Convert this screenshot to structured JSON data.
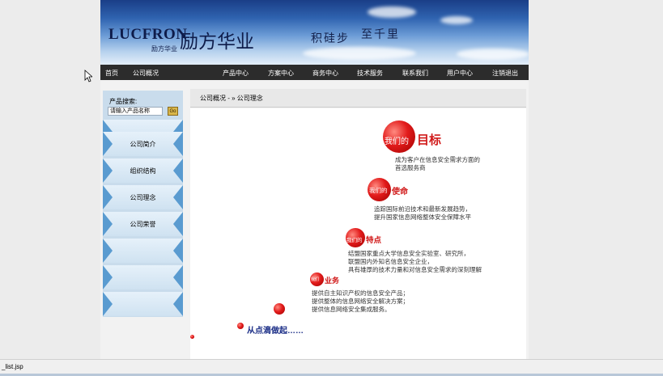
{
  "banner": {
    "logo_en": "LUCFRON",
    "logo_cn": "励方华业",
    "logo_sub": "励方华业",
    "slogan_part1": "积硅步",
    "slogan_part2": "至千里"
  },
  "nav": {
    "items": [
      "首页",
      "公司概况",
      "",
      "产品中心",
      "方案中心",
      "商务中心",
      "技术服务",
      "联系我们",
      "用户中心",
      "注销退出"
    ]
  },
  "sidebar": {
    "search_label": "产品搜索:",
    "search_placeholder": "请输入产品名称",
    "search_go": "Go",
    "tabs": [
      "",
      "公司简介",
      "组织结构",
      "公司理念",
      "公司荣誉",
      "",
      "",
      ""
    ]
  },
  "breadcrumb": {
    "text": "公司概况  - » 公司理念"
  },
  "content": {
    "sections": [
      {
        "ball_text": "我们的",
        "heading": "目标",
        "lines": [
          "成为客户在信息安全需求方面的",
          "首选服务商"
        ]
      },
      {
        "ball_text": "我们的",
        "heading": "使命",
        "lines": [
          "追踪国际前沿技术和最新发展趋势，",
          "提升国家信息网络整体安全保障水平"
        ]
      },
      {
        "ball_text": "我们的",
        "heading": "特点",
        "lines": [
          "结盟国家重点大学信息安全实验室、研究所，",
          "联盟国内外知名信息安全企业，",
          "具有雄厚的技术力量和对信息安全需求的深刻理解"
        ]
      },
      {
        "ball_text": "我们",
        "heading": "业务",
        "lines": [
          "提供自主知识产权的信息安全产品；",
          "提供整体的信息网络安全解决方案；",
          "提供信息网络安全集成服务。"
        ]
      }
    ],
    "closing": "从点滴做起……"
  },
  "statusbar": {
    "text": "_list.jsp"
  },
  "colors": {
    "nav_bg": "#2c2c2c",
    "accent_red": "#d11a1a",
    "closing_blue": "#1a2d86",
    "sidebar_arrow": "#5a9bd0"
  }
}
